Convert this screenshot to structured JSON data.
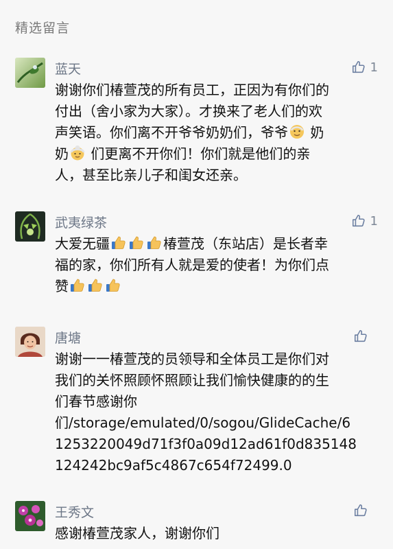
{
  "section": {
    "title": "精选留言"
  },
  "comments": [
    {
      "name": "蓝天",
      "likes": "1",
      "lines": [
        "谢谢你们椿萱茂的所有员工，正因为有你们的",
        "付出（舍小家为大家）。才换来了老人们的欢",
        "声笑语。你们离不开爷爷奶奶们，爷爷",
        "奶",
        "奶",
        "们更离不开你们！你们就是他们的亲",
        "人，甚至比亲儿子和闺女还亲。"
      ],
      "emoji": {
        "grandpa": "older-man-emoji",
        "grandma": "older-woman-emoji"
      }
    },
    {
      "name": "武夷绿茶",
      "likes": "1",
      "lines": [
        "大爱无疆",
        "椿萱茂（东站店）是长者幸",
        "福的家，你们所有人就是爱的使者！为你们点",
        "赞"
      ],
      "emoji": {
        "thumb": "thumbs-up-emoji"
      }
    },
    {
      "name": "唐塘",
      "likes": "",
      "lines": [
        "谢谢一一椿萱茂的员领导和全体员工是你们对",
        "我们的关怀照顾怀照顾让我们愉快健康的的生",
        "们春节感谢你",
        "们/storage/emulated/0/sogou/GlideCache/6",
        "1253220049d71f3f0a09d12ad61f0d835148",
        "124242bc9af5c4867c654f72499.0"
      ]
    },
    {
      "name": "王秀文",
      "likes": "",
      "lines": [
        "感谢椿萱茂家人，谢谢你们"
      ]
    }
  ],
  "colors": {
    "background": "#f7f7f7",
    "name": "#6d7787",
    "text": "#111111",
    "muted": "#7a7a7a",
    "like_icon": "#6c7fa1"
  },
  "icons": {
    "like": "thumbs-up-outline-icon"
  }
}
